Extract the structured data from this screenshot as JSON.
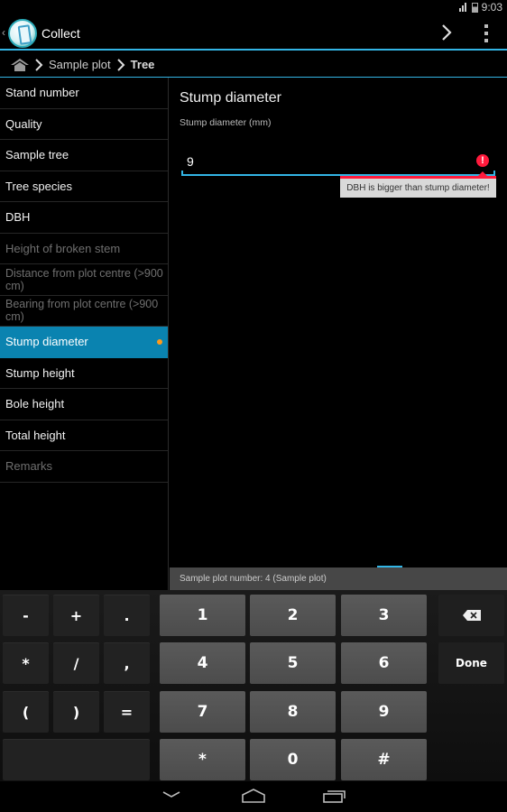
{
  "status_bar": {
    "network": "3G",
    "time": "9:03"
  },
  "action_bar": {
    "title": "Collect",
    "icons": [
      "back-caret-icon",
      "app-logo-icon",
      "chevron-right-icon",
      "overflow-menu-icon"
    ]
  },
  "breadcrumb": {
    "home_icon": "home-icon",
    "items": [
      "Sample plot",
      "Tree"
    ]
  },
  "sidebar": {
    "items": [
      {
        "label": "Stand number",
        "state": "normal"
      },
      {
        "label": "Quality",
        "state": "normal"
      },
      {
        "label": "Sample tree",
        "state": "normal"
      },
      {
        "label": "Tree species",
        "state": "normal"
      },
      {
        "label": "DBH",
        "state": "normal"
      },
      {
        "label": "Height of broken stem",
        "state": "disabled"
      },
      {
        "label": "Distance from plot centre (>900 cm)",
        "state": "disabled"
      },
      {
        "label": "Bearing from plot centre (>900 cm)",
        "state": "disabled"
      },
      {
        "label": "Stump diameter",
        "state": "active"
      },
      {
        "label": "Stump height",
        "state": "normal"
      },
      {
        "label": "Bole height",
        "state": "normal"
      },
      {
        "label": "Total height",
        "state": "normal"
      },
      {
        "label": "Remarks",
        "state": "disabled"
      }
    ]
  },
  "form": {
    "title": "Stump diameter",
    "field_label": "Stump diameter (mm)",
    "field_value": "9",
    "error_message": "DBH is bigger than stump diameter!",
    "accent_color": "#33b5e5",
    "error_color": "#ff1a3c"
  },
  "info_bar": {
    "text": "Sample plot number: 4 (Sample plot)"
  },
  "keyboard": {
    "symbol_keys": [
      "-",
      "+",
      ".",
      "*",
      "/",
      ",",
      "(",
      ")",
      "="
    ],
    "number_keys": [
      "1",
      "2",
      "3",
      "4",
      "5",
      "6",
      "7",
      "8",
      "9",
      "*",
      "0",
      "#"
    ],
    "backspace_icon": "backspace-icon",
    "done_label": "Done"
  },
  "nav_bar": {
    "icons": [
      "back-down-icon",
      "home-icon",
      "recent-apps-icon"
    ]
  }
}
